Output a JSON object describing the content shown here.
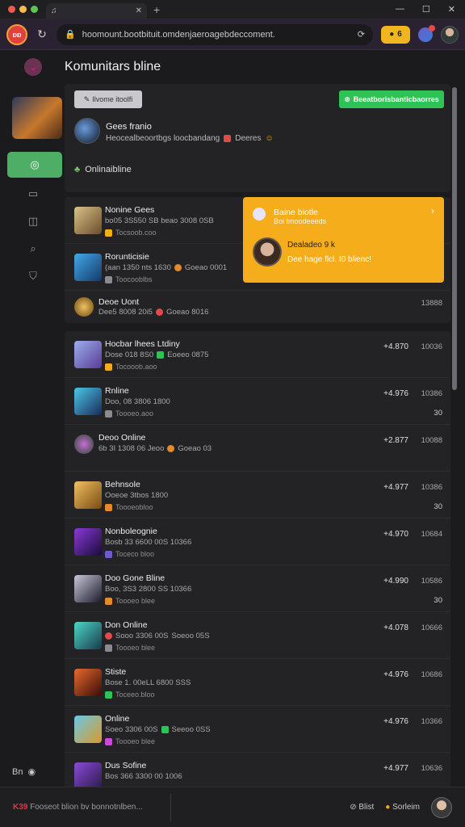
{
  "window": {
    "tab_title": "",
    "controls": [
      "—",
      "☐",
      "✕"
    ]
  },
  "addressbar": {
    "brand": "ɒɒ",
    "url": "hoomount.bootbituit.omdenjaeroagebdeccoment.",
    "coins": "6"
  },
  "header": {
    "title": "Komunitars bline"
  },
  "profile": {
    "btn_left": "Ilvome itoolfi",
    "btn_right": "Beeatborisbanticbaorres",
    "name": "Gees franio",
    "subtitle": "Heocealbeoortbgs loocbandang",
    "subtitle_tag": "Deeres",
    "status": "Onlinaibline"
  },
  "popup": {
    "title": "Baine biotle",
    "subtitle": "Boi Imoodeeeds",
    "name": "Dealadeo 9 k",
    "text": "Dee hage flcl. I0 blienc!"
  },
  "featured": [
    {
      "title": "Nonine Gees",
      "meta": "bo05 3S550 SB beao 3008 0SB",
      "sub": "Tocsoob.coo",
      "val": "",
      "val2": ""
    },
    {
      "title": "Rorunticisie",
      "meta": "(aan 1350 nts 1630",
      "meta_tag": "Goeao 0001",
      "sub": "Toocooblbs",
      "val": "",
      "val2": ""
    },
    {
      "title": "Deoe Uont",
      "meta": "Dee5 8008 20i5",
      "meta_tag": "Goeao 8016",
      "sub": "",
      "val": "",
      "val2": "13888"
    }
  ],
  "rows": [
    {
      "title": "Hocbar lhees Ltdiny",
      "meta": "Dose 018 8S0",
      "meta_tag": "Eoeeo 0875",
      "sub": "Tocooob.aoo",
      "val": "+4.870",
      "val2": "10036",
      "extra": ""
    },
    {
      "title": "Rnline",
      "meta": "Doo, 08 3806 1800",
      "meta_tag": "",
      "sub": "Toooeo.aoo",
      "val": "+4.976",
      "val2": "10386",
      "extra": "30"
    },
    {
      "title": "Deoo Online",
      "meta": "6b 3I 1308 06 Jeoo",
      "meta_tag": "Goeao 03",
      "sub": "",
      "val": "+2.877",
      "val2": "10088",
      "extra": ""
    },
    {
      "title": "Behnsole",
      "meta": "Ooeoe 3tbos 1800",
      "meta_tag": "",
      "sub": "Toooeobloo",
      "val": "+4.977",
      "val2": "10386",
      "extra": "30"
    },
    {
      "title": "Nonboleognie",
      "meta": "Bosb 33 6600 00S 10366",
      "meta_tag": "",
      "sub": "Toceco bloo",
      "val": "+4.970",
      "val2": "10684",
      "extra": ""
    },
    {
      "title": "Doo Gone Bline",
      "meta": "Boo, 3S3 2800 SS 10366",
      "meta_tag": "",
      "sub": "Toooeo blee",
      "val": "+4.990",
      "val2": "10586",
      "extra": "30"
    },
    {
      "title": "Don Online",
      "meta": "Sooo 3306 00S",
      "meta_tag": "Soeoo 05S",
      "sub": "Toooeo blee",
      "val": "+4.078",
      "val2": "10666",
      "extra": ""
    },
    {
      "title": "Stiste",
      "meta": "Bose 1. 00eLL 6800 SSS",
      "meta_tag": "",
      "sub": "Toceeo.bloo",
      "val": "+4.976",
      "val2": "10686",
      "extra": ""
    },
    {
      "title": "Online",
      "meta": "Soeo 3306 00S",
      "meta_tag": "Seeoo 0SS",
      "sub": "Toooeo blee",
      "val": "+4.976",
      "val2": "10366",
      "extra": ""
    },
    {
      "title": "Dus Sofine",
      "meta": "Bos 366 3300 00 1006",
      "meta_tag": "",
      "sub": "",
      "val": "+4.977",
      "val2": "10636",
      "extra": ""
    }
  ],
  "sidebar": {
    "bottom_label": "Bn"
  },
  "footer": {
    "left_code": "K39",
    "left_text": "Fooseot blion bv bonnotnlben...",
    "item1": "Blist",
    "item2": "Sorleim"
  },
  "colors": {
    "accent_green": "#2fc255",
    "accent_orange": "#f5ad1c",
    "brand_red": "#e0413a"
  }
}
